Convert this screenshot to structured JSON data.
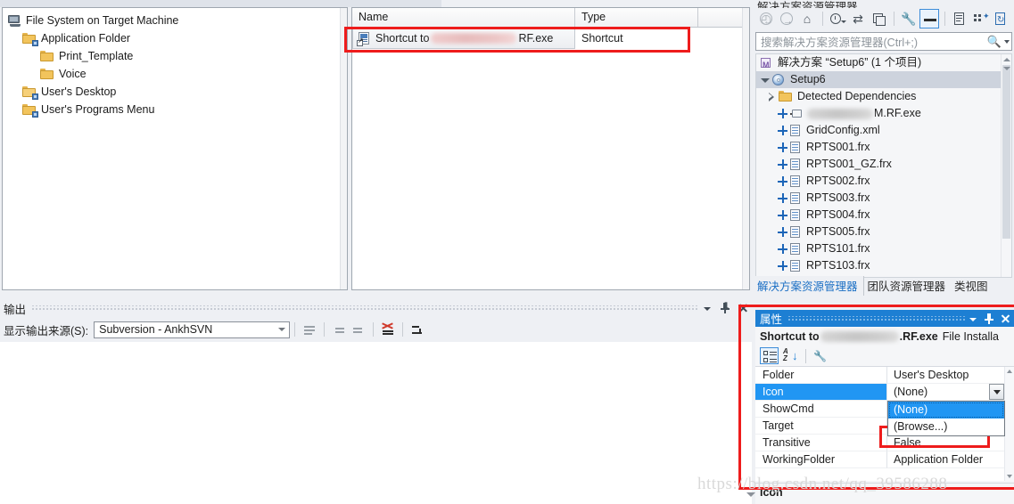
{
  "file_system_tree": {
    "root_label": "File System on Target Machine",
    "nodes": [
      {
        "label": "Application Folder",
        "icon": "folder-icon",
        "indent": 1
      },
      {
        "label": "Print_Template",
        "icon": "folder-icon",
        "indent": 2
      },
      {
        "label": "Voice",
        "icon": "folder-icon",
        "indent": 2
      },
      {
        "label": "User's Desktop",
        "icon": "folder-open-icon",
        "indent": 1
      },
      {
        "label": "User's Programs Menu",
        "icon": "folder-icon",
        "indent": 1
      }
    ]
  },
  "list_view": {
    "columns": [
      "Name",
      "Type"
    ],
    "rows": [
      {
        "name_prefix": "Shortcut to ",
        "name_redacted": true,
        "name_suffix": "RF.exe",
        "type": "Shortcut",
        "icon": "shortcut-icon"
      }
    ]
  },
  "output_pane": {
    "title": "输出",
    "source_label": "显示输出来源(S):",
    "source_value": "Subversion - AnkhSVN",
    "body_text": ""
  },
  "solution_explorer": {
    "title": "解决方案资源管理器",
    "search_placeholder": "搜索解决方案资源管理器(Ctrl+;)",
    "toolbar_icons": [
      "back-icon",
      "forward-icon",
      "home-icon",
      "pending-changes-icon",
      "sync-icon",
      "collapse-all-icon",
      "properties-wrench-icon",
      "show-all-files-icon",
      "view-code-icon",
      "view-designer-icon",
      "refresh-icon"
    ],
    "solution_label": "解决方案 “Setup6” (1 个项目)",
    "project_label": "Setup6",
    "detected_dependencies_label": "Detected Dependencies",
    "files": [
      {
        "label": "M.RF.exe",
        "redacted": true,
        "icon": "exe-icon"
      },
      {
        "label": "GridConfig.xml",
        "redacted": false,
        "icon": "file-icon"
      },
      {
        "label": "RPTS001.frx",
        "redacted": false,
        "icon": "file-icon"
      },
      {
        "label": "RPTS001_GZ.frx",
        "redacted": false,
        "icon": "file-icon"
      },
      {
        "label": "RPTS002.frx",
        "redacted": false,
        "icon": "file-icon"
      },
      {
        "label": "RPTS003.frx",
        "redacted": false,
        "icon": "file-icon"
      },
      {
        "label": "RPTS004.frx",
        "redacted": false,
        "icon": "file-icon"
      },
      {
        "label": "RPTS005.frx",
        "redacted": false,
        "icon": "file-icon"
      },
      {
        "label": "RPTS101.frx",
        "redacted": false,
        "icon": "file-icon"
      },
      {
        "label": "RPTS103.frx",
        "redacted": false,
        "icon": "file-icon"
      }
    ],
    "tabs": [
      {
        "label": "解决方案资源管理器",
        "active": true
      },
      {
        "label": "团队资源管理器",
        "active": false
      },
      {
        "label": "类视图",
        "active": false
      }
    ]
  },
  "properties_pane": {
    "title": "属性",
    "object_name_prefix": "Shortcut to ",
    "object_name_suffix": ".RF.exe",
    "object_class": "File Installa",
    "toolbar_icons": [
      "categorized-icon",
      "alphabetical-icon",
      "property-pages-icon"
    ],
    "rows": [
      {
        "key": "Folder",
        "value": "User's Desktop",
        "selected": false
      },
      {
        "key": "Icon",
        "value": "(None)",
        "selected": true
      },
      {
        "key": "ShowCmd",
        "value": "",
        "selected": false
      },
      {
        "key": "Target",
        "value": "",
        "selected": false
      },
      {
        "key": "Transitive",
        "value": "False",
        "selected": false
      },
      {
        "key": "WorkingFolder",
        "value": "Application Folder",
        "selected": false
      }
    ],
    "dropdown": {
      "open": true,
      "options": [
        {
          "label": "(None)",
          "highlighted": true
        },
        {
          "label": "(Browse...)",
          "highlighted": false
        }
      ]
    },
    "description_name": "Icon",
    "description_text": ""
  },
  "watermark": "https://blog.csdn.net/qq_39586288",
  "colors": {
    "accent_blue": "#1d7fd3",
    "selection_blue": "#2196f3",
    "annotation_red": "#ee1c1c",
    "panel_bg": "#eef0f4"
  }
}
